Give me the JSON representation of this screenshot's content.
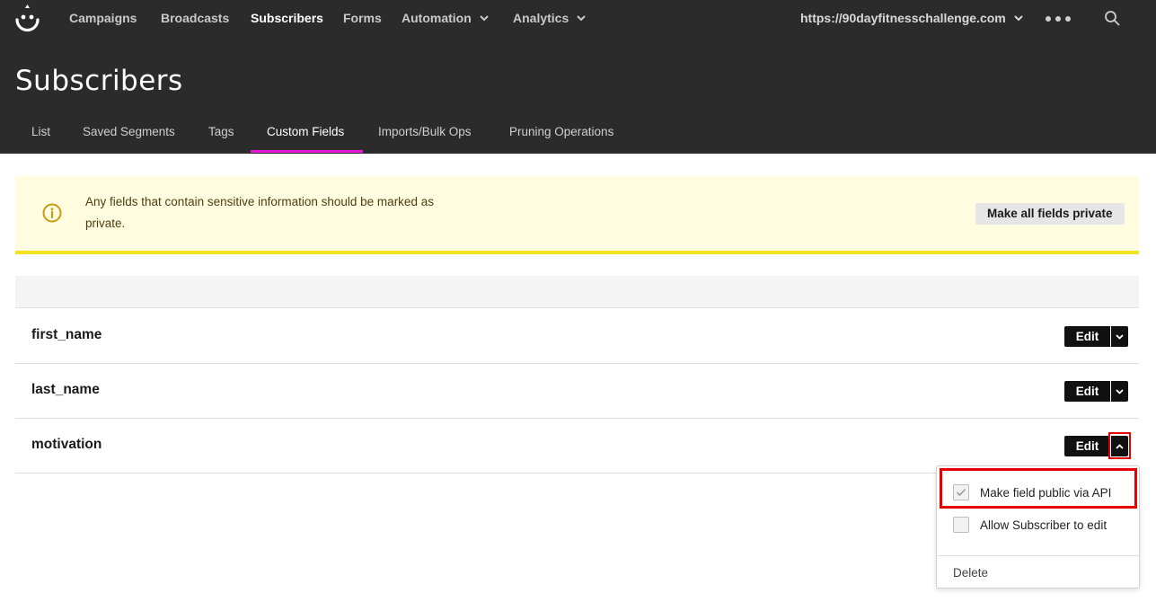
{
  "nav": {
    "items": [
      {
        "label": "Campaigns"
      },
      {
        "label": "Broadcasts"
      },
      {
        "label": "Subscribers"
      },
      {
        "label": "Forms"
      },
      {
        "label": "Automation"
      },
      {
        "label": "Analytics"
      }
    ],
    "active": "Subscribers",
    "domain": "https://90dayfitnesschallenge.com",
    "icons": [
      "logo-icon",
      "chevron-down-icon",
      "more-icon",
      "search-icon"
    ]
  },
  "page": {
    "title": "Subscribers"
  },
  "tabs": [
    {
      "label": "List"
    },
    {
      "label": "Saved Segments"
    },
    {
      "label": "Tags"
    },
    {
      "label": "Custom Fields"
    },
    {
      "label": "Imports/Bulk Ops"
    },
    {
      "label": "Pruning Operations"
    }
  ],
  "active_tab": "Custom Fields",
  "notice": {
    "text": "Any fields that contain sensitive information should be marked as private.",
    "button": "Make all fields private",
    "icon": "info-icon"
  },
  "fields": [
    {
      "name": "first_name",
      "edit_label": "Edit"
    },
    {
      "name": "last_name",
      "edit_label": "Edit"
    },
    {
      "name": "motivation",
      "edit_label": "Edit"
    }
  ],
  "dropdown": {
    "options": [
      {
        "label": "Make field public via API",
        "checked": true
      },
      {
        "label": "Allow Subscriber to edit",
        "checked": false
      }
    ],
    "delete_label": "Delete"
  },
  "colors": {
    "header_bg": "#2b2b2b",
    "active_tab_underline": "#e81ad6",
    "notice_bg": "#fffce0",
    "notice_border": "#f2e21f",
    "highlight": "#e60000"
  }
}
